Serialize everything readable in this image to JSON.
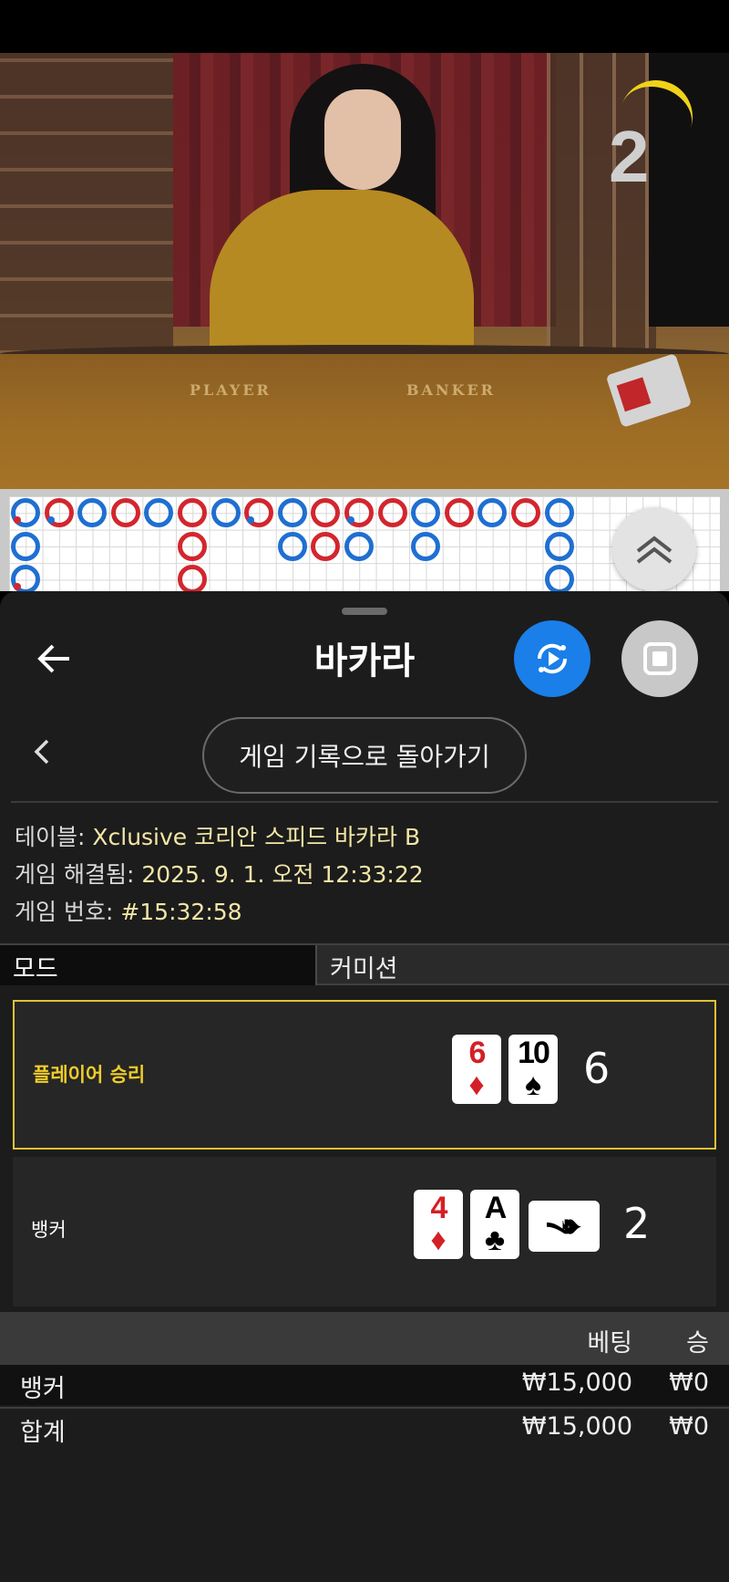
{
  "video": {
    "countdown": "2",
    "table_labels": [
      "PLAYER",
      "BANKER"
    ]
  },
  "road": {
    "top_row": [
      "blue-red-dot",
      "red-blue-dot",
      "blue",
      "red",
      "blue",
      "red",
      "blue",
      "red-blue-dot",
      "blue",
      "red",
      "red-blue-dot",
      "red",
      "blue",
      "red",
      "blue",
      "red",
      "blue"
    ],
    "toggle_icon": "double-chevron-up-icon"
  },
  "sheet": {
    "title": "바카라",
    "history_button": "게임 기록으로 돌아가기",
    "info": {
      "table_label": "테이블: ",
      "table_value": "Xclusive 코리안 스피드 바카라 B",
      "resolved_label": "게임 해결됨: ",
      "resolved_value": "2025. 9. 1. 오전 12:33:22",
      "number_label": "게임 번호: ",
      "number_value": "#15:32:58"
    },
    "mode": {
      "left": "모드",
      "right": "커미션"
    },
    "player": {
      "label": "플레이어 승리",
      "score": "6",
      "cards": [
        {
          "rank": "6",
          "suit": "♦",
          "color": "red"
        },
        {
          "rank": "10",
          "suit": "♠",
          "color": "black"
        }
      ]
    },
    "banker": {
      "label": "뱅커",
      "score": "2",
      "cards": [
        {
          "rank": "4",
          "suit": "♦",
          "color": "red"
        },
        {
          "rank": "A",
          "suit": "♣",
          "color": "black"
        },
        {
          "rank": "7",
          "suit": "♠",
          "color": "black",
          "sideways": true
        }
      ]
    },
    "bets": {
      "col_bet": "베팅",
      "col_win": "승",
      "rows": [
        {
          "name": "뱅커",
          "amount": "₩15,000",
          "win": "₩0"
        }
      ],
      "total": {
        "name": "합계",
        "amount": "₩15,000",
        "win": "₩0"
      }
    }
  },
  "colors": {
    "accent_blue": "#1a7fe8",
    "win_gold": "#f0cd28",
    "info_value": "#f3e6a6"
  }
}
